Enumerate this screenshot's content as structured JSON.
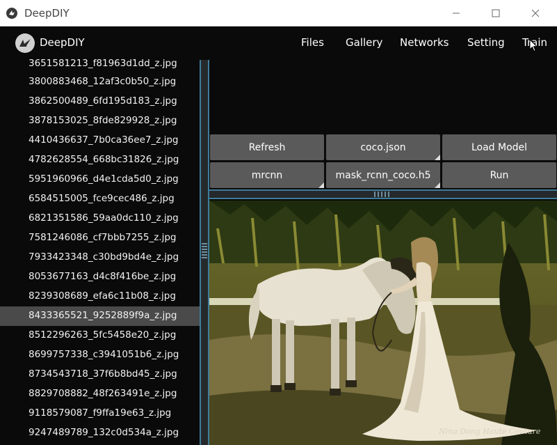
{
  "window": {
    "title": "DeepDIY",
    "controls": [
      "minimize-icon",
      "maximize-icon",
      "close-icon"
    ]
  },
  "menubar": {
    "brand": "DeepDIY",
    "items": [
      {
        "label": "Files"
      },
      {
        "label": "Gallery"
      },
      {
        "label": "Networks"
      },
      {
        "label": "Setting"
      },
      {
        "label": "Train"
      }
    ]
  },
  "files": {
    "selected_index": 13,
    "items": [
      "3651581213_f81963d1dd_z.jpg",
      "3800883468_12af3c0b50_z.jpg",
      "3862500489_6fd195d183_z.jpg",
      "3878153025_8fde829928_z.jpg",
      "4410436637_7b0ca36ee7_z.jpg",
      "4782628554_668bc31826_z.jpg",
      "5951960966_d4e1cda5d0_z.jpg",
      "6584515005_fce9cec486_z.jpg",
      "6821351586_59aa0dc110_z.jpg",
      "7581246086_cf7bbb7255_z.jpg",
      "7933423348_c30bd9bd4e_z.jpg",
      "8053677163_d4c8f416be_z.jpg",
      "8239308689_efa6c11b08_z.jpg",
      "8433365521_9252889f9a_z.jpg",
      "8512296263_5fc5458e20_z.jpg",
      "8699757338_c3941051b6_z.jpg",
      "8734543718_37f6b8bd45_z.jpg",
      "8829708882_48f263491e_z.jpg",
      "9118579087_f9ffa19e63_z.jpg",
      "9247489789_132c0d534a_z.jpg"
    ]
  },
  "toolbar": {
    "refresh": "Refresh",
    "config_file": "coco.json",
    "load_model": "Load Model",
    "network": "mrcnn",
    "weights_file": "mask_rcnn_coco.h5",
    "run": "Run"
  },
  "preview": {
    "watermark": "Nina Dong Haute Couture"
  },
  "colors": {
    "button_bg": "#5a5a5a",
    "splitter_border": "#3e7d9a",
    "selected_row": "#4a4a4a"
  }
}
